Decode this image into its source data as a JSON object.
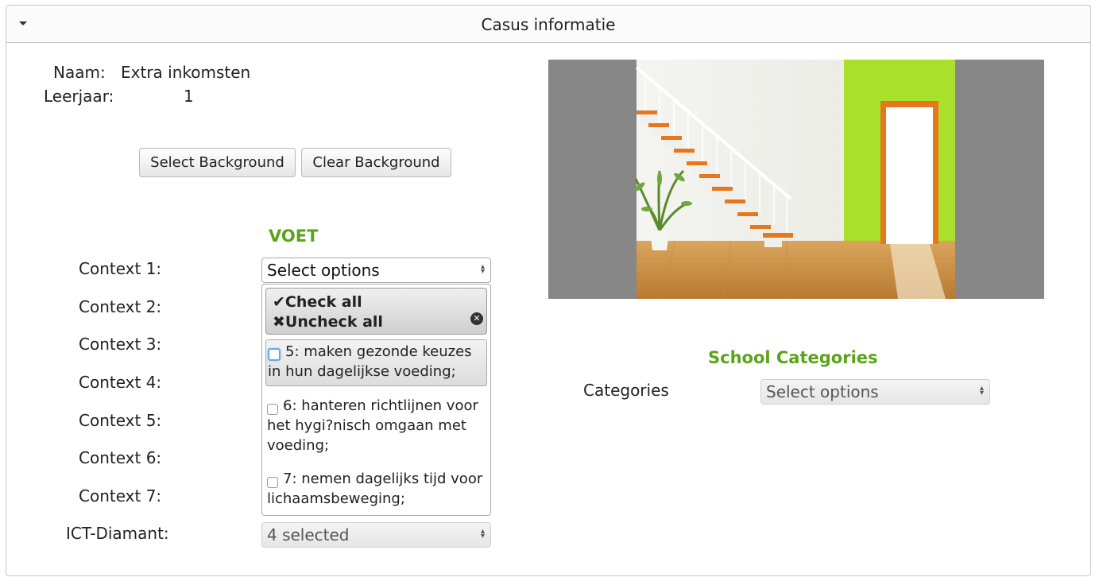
{
  "panel": {
    "title": "Casus informatie"
  },
  "info": {
    "naam_label": "Naam:",
    "naam_value": "Extra inkomsten",
    "leerjaar_label": "Leerjaar:",
    "leerjaar_value": "1"
  },
  "buttons": {
    "select_background": "Select Background",
    "clear_background": "Clear Background"
  },
  "voet": {
    "title": "VOET",
    "contexts": [
      "Context 1:",
      "Context 2:",
      "Context 3:",
      "Context 4:",
      "Context 5:",
      "Context 6:",
      "Context 7:"
    ],
    "select_placeholder": "Select options",
    "ict_label": "ICT-Diamant:",
    "ict_value": "4 selected"
  },
  "dropdown": {
    "check_all": "Check all",
    "uncheck_all": "Uncheck all",
    "options": [
      {
        "text": "5: maken gezonde keuzes in hun dagelijkse voeding;",
        "checked": false
      },
      {
        "text": "6: hanteren richtlijnen voor het hygi?nisch omgaan met voeding;",
        "checked": false
      },
      {
        "text": "7: nemen dagelijks tijd voor lichaamsbeweging;",
        "checked": false
      }
    ]
  },
  "school": {
    "title": "School Categories",
    "categories_label": "Categories",
    "select_placeholder": "Select options"
  },
  "icons": {
    "collapse": "triangle-down-icon",
    "check": "check-icon",
    "cross": "cross-icon",
    "close": "close-circle-icon",
    "select_arrows": "updown-arrows-icon"
  },
  "colors": {
    "accent": "#5aa516",
    "wall_green": "#a8e02c",
    "door_orange": "#e8761c"
  }
}
